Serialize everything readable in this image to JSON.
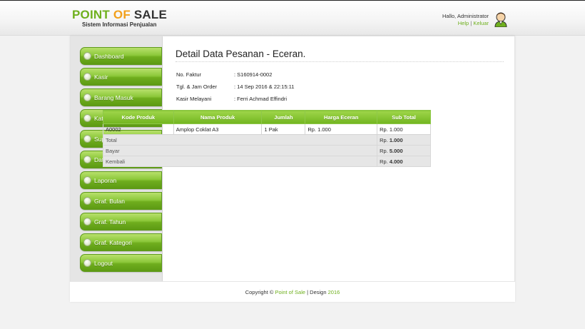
{
  "header": {
    "logo_word1": "POINT",
    "logo_word2": "OF",
    "logo_word3": "SALE",
    "logo_subtitle": "Sistem Informasi Penjualan",
    "greeting": "Hallo, Administrator",
    "help_link": "Help",
    "link_separator": "|",
    "logout_link": "Keluar",
    "avatar_icon": "user-avatar-icon"
  },
  "sidebar": {
    "items": [
      {
        "label": "Dashboard"
      },
      {
        "label": "Kasir"
      },
      {
        "label": "Barang Masuk"
      },
      {
        "label": "Kategori"
      },
      {
        "label": "Suppliers"
      },
      {
        "label": "Data Customer"
      },
      {
        "label": "Laporan"
      },
      {
        "label": "Graf. Bulan"
      },
      {
        "label": "Graf. Tahun"
      },
      {
        "label": "Graf. Kategori"
      },
      {
        "label": "Logout"
      }
    ]
  },
  "main": {
    "title": "Detail Data Pesanan - Eceran.",
    "info": [
      {
        "label": "No. Faktur",
        "value": ": S160914-0002"
      },
      {
        "label": "Tgl. & Jam Order",
        "value": ": 14 Sep 2016 & 22:15:11"
      },
      {
        "label": "Kasir Melayani",
        "value": ": Ferri Achmad Effindri"
      }
    ],
    "table": {
      "headers": [
        "Kode Produk",
        "Nama Produk",
        "Jumlah",
        "Harga Eceran",
        "Sub Total"
      ],
      "rows": [
        {
          "kode": "A0002",
          "nama": "Amplop Coklat A3",
          "jumlah": "1 Pak",
          "harga": "Rp. 1.000",
          "subtotal": "Rp. 1.000"
        }
      ],
      "summary": [
        {
          "label": "Total",
          "currency": "Rp.",
          "amount": "1.000"
        },
        {
          "label": "Bayar",
          "currency": "Rp.",
          "amount": "5.000"
        },
        {
          "label": "Kembali",
          "currency": "Rp.",
          "amount": "4.000"
        }
      ]
    }
  },
  "footer": {
    "prefix": "Copyright ©",
    "brand": "Point of Sale",
    "middle": "| Design",
    "year": "2016"
  },
  "colors": {
    "accent_green": "#6fb01e",
    "accent_orange": "#f2a01c",
    "table_header_green": "#8cc83a"
  }
}
